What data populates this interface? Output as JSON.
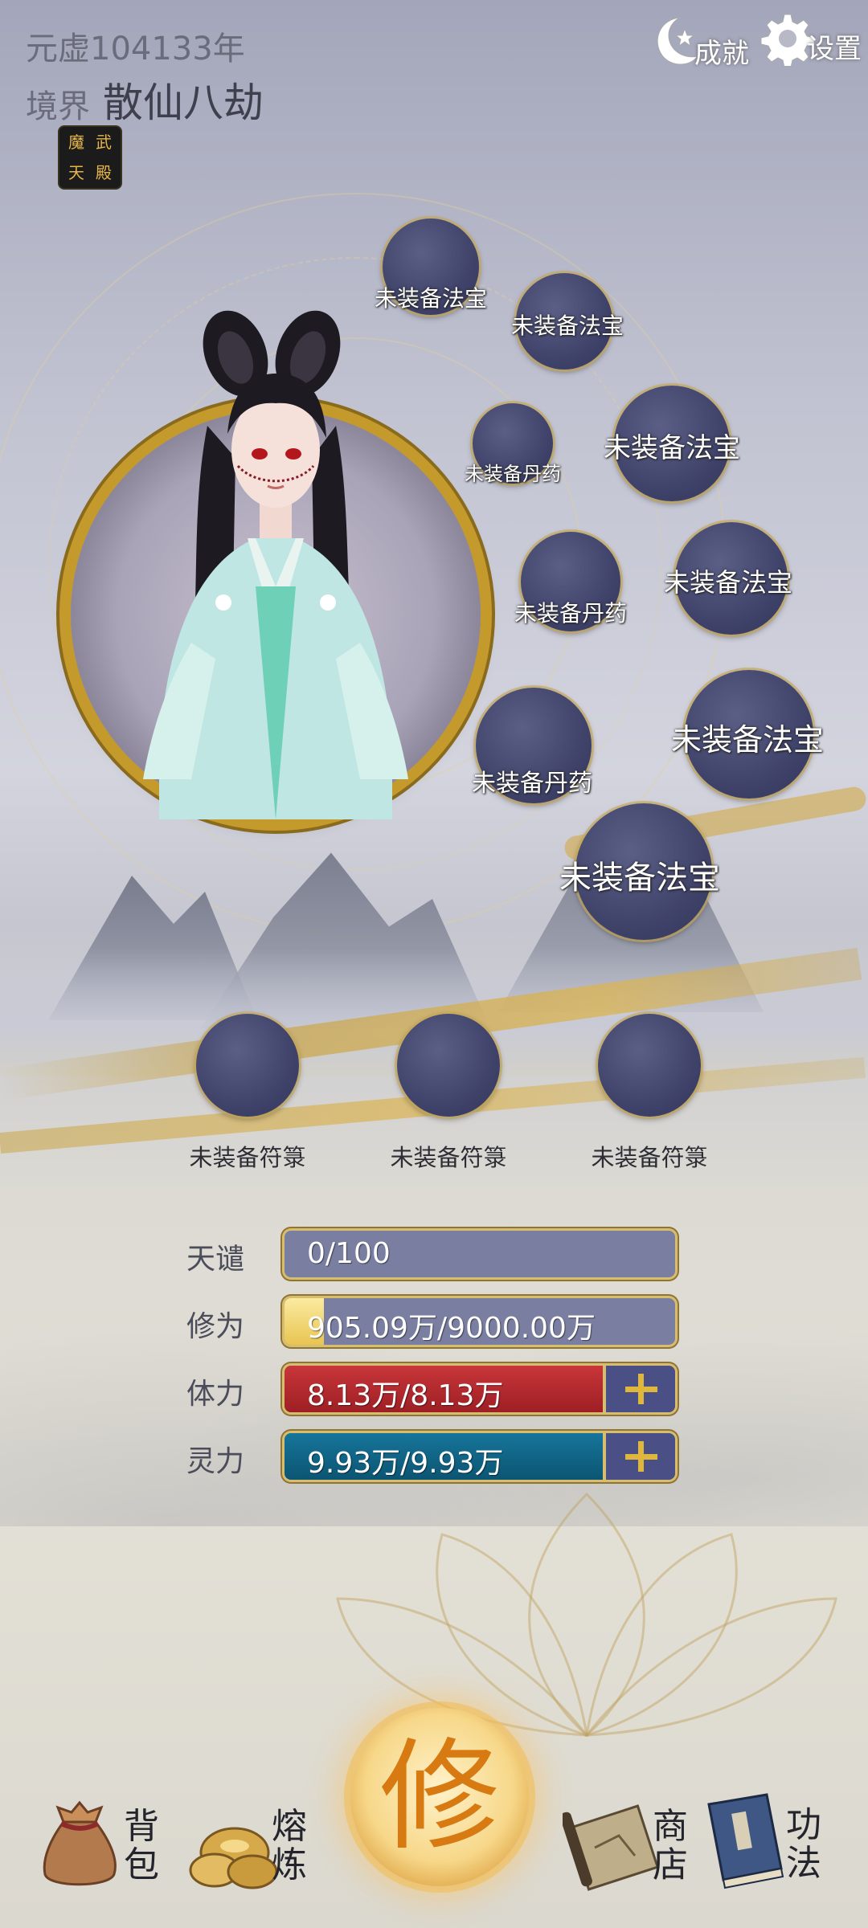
{
  "header": {
    "year": "元虚104133年",
    "realm_label": "境界",
    "realm_value": "散仙八劫",
    "badge_chars": [
      "魔",
      "武",
      "天",
      "殿"
    ],
    "achievements_label": "成就",
    "settings_label": "设置"
  },
  "slots": {
    "treasure_1": "未装备法宝",
    "treasure_2": "未装备法宝",
    "pill_1": "未装备丹药",
    "treasure_3": "未装备法宝",
    "pill_2": "未装备丹药",
    "treasure_4": "未装备法宝",
    "pill_3": "未装备丹药",
    "treasure_5": "未装备法宝",
    "treasure_6": "未装备法宝",
    "talisman_1": "未装备符箓",
    "talisman_2": "未装备符箓",
    "talisman_3": "未装备符箓"
  },
  "stats": {
    "tribulation": {
      "label": "天谴",
      "value": "0/100",
      "fraction": 0.0
    },
    "cultivation": {
      "label": "修为",
      "value": "905.09万/9000.00万",
      "fraction": 0.1
    },
    "stamina": {
      "label": "体力",
      "value": "8.13万/8.13万",
      "fraction": 1.0
    },
    "spirit": {
      "label": "灵力",
      "value": "9.93万/9.93万",
      "fraction": 1.0
    }
  },
  "nav": {
    "bag_line1": "背",
    "bag_line2": "包",
    "smelt_line1": "熔",
    "smelt_line2": "炼",
    "cultivate": "修",
    "shop_line1": "商",
    "shop_line2": "店",
    "skills_line1": "功",
    "skills_line2": "法"
  },
  "colors": {
    "slot_fill": "#40436a",
    "gold": "#d7bd6f",
    "stamina_bar": "#b0262a",
    "spirit_bar": "#0e5e7d",
    "cultivation_fill": "#f2dc7b",
    "empty_bar": "#7a7fa2"
  },
  "icons": {
    "achievements": "moon-star-icon",
    "settings": "gear-icon",
    "bag": "money-pouch-icon",
    "smelt": "gold-ingots-icon",
    "shop": "scroll-map-icon",
    "skills": "book-icon"
  }
}
